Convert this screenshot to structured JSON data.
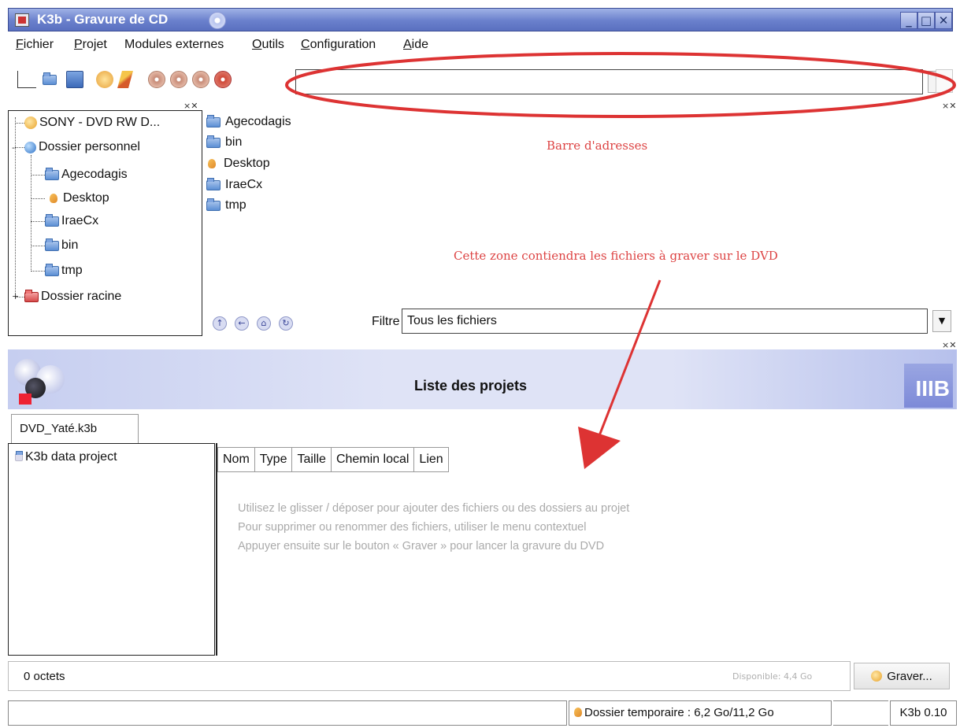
{
  "window": {
    "title": "K3b - Gravure de CD"
  },
  "menu": {
    "items": [
      {
        "first": "F",
        "rest": "ichier"
      },
      {
        "first": "P",
        "rest": "rojet"
      },
      {
        "first": "",
        "rest": "Modules externes"
      },
      {
        "first": "O",
        "rest": "utils",
        "pre": ""
      },
      {
        "first": "C",
        "rest": "onfiguration"
      },
      {
        "first": "A",
        "rest": "ide"
      }
    ]
  },
  "toolbar": {
    "url_value": ""
  },
  "tree": {
    "items": [
      {
        "label": "SONY - DVD RW D...",
        "icon": "drive-icon"
      },
      {
        "label": "Dossier personnel",
        "icon": "globe-icon"
      },
      {
        "label": "Agecodagis",
        "icon": "folder-icon"
      },
      {
        "label": "Desktop",
        "icon": "desktop-icon"
      },
      {
        "label": "IraeCx",
        "icon": "folder-icon"
      },
      {
        "label": "bin",
        "icon": "folder-icon"
      },
      {
        "label": "tmp",
        "icon": "folder-icon"
      },
      {
        "label": "Dossier racine",
        "icon": "folder-red-icon"
      }
    ]
  },
  "files": {
    "items": [
      "Agecodagis",
      "bin",
      "Desktop",
      "IraeCx",
      "tmp"
    ]
  },
  "annotations": {
    "address_bar": "Barre d'adresses",
    "drop_zone": "Cette zone contiendra les fichiers à graver sur le DVD"
  },
  "filter": {
    "label": "Filtre :",
    "value": "Tous les fichiers"
  },
  "projects": {
    "banner_title": "Liste des projets",
    "logo_text": "IIIB",
    "tab_label": "DVD_Yaté.k3b",
    "root_item": "K3b data project",
    "columns": [
      "Nom",
      "Type",
      "Taille",
      "Chemin local",
      "Lien"
    ],
    "hints": [
      "Utilisez le glisser / déposer pour ajouter des fichiers ou des dossiers au projet",
      "Pour supprimer ou renommer des fichiers, utiliser le menu contextuel",
      "Appuyer ensuite sur le bouton « Graver » pour lancer la gravure du DVD"
    ],
    "size": "0 octets",
    "available": "Disponible: 4,4 Go",
    "burn_label": "Graver..."
  },
  "status": {
    "temp_dir": "Dossier temporaire : 6,2 Go/11,2 Go",
    "version": "K3b 0.10"
  },
  "colors": {
    "annotation": "#dd3333",
    "titlebar": "#6a80cc",
    "banner": "#dfe3f6"
  }
}
